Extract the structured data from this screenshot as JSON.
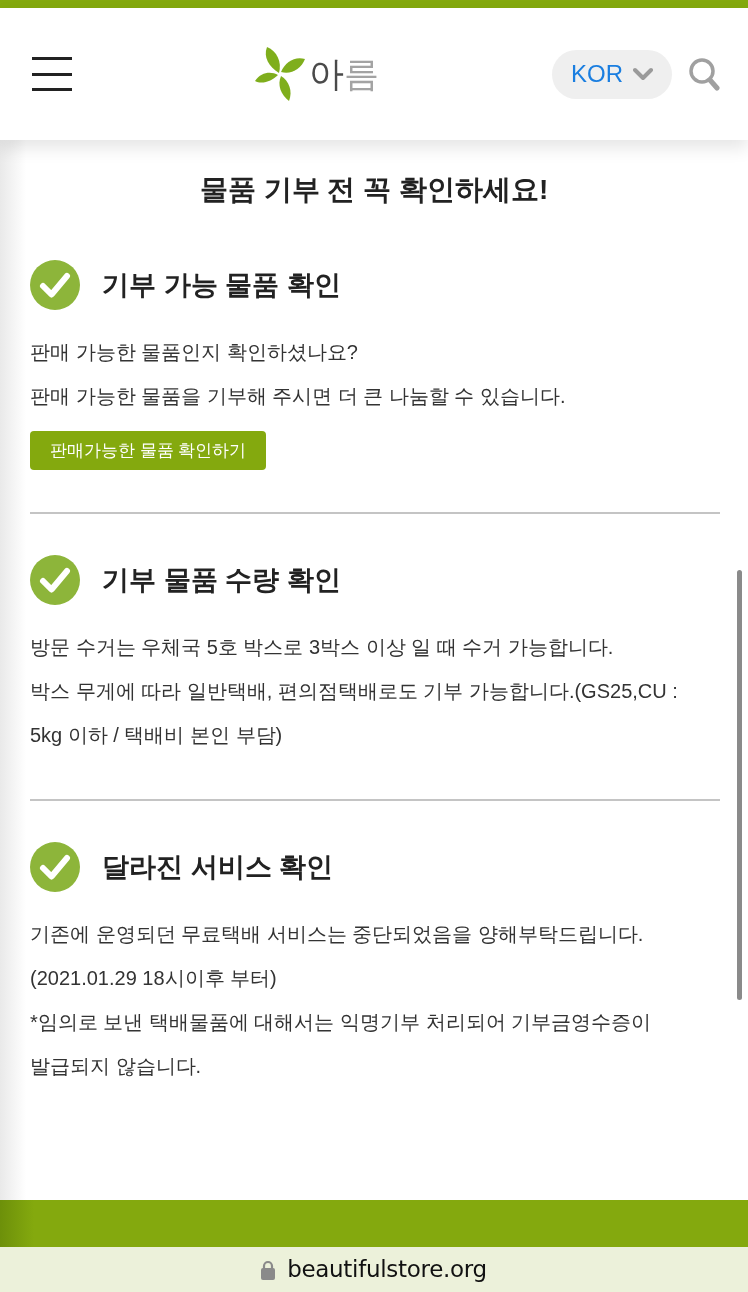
{
  "header": {
    "logo": {
      "text": "아름"
    },
    "language": {
      "label": "KOR"
    }
  },
  "page_title": "물품 기부 전 꼭 확인하세요!",
  "sections": [
    {
      "heading": "기부 가능 물품 확인",
      "lines": [
        "판매 가능한 물품인지 확인하셨나요?",
        "판매 가능한 물품을 기부해 주시면 더 큰 나눔할 수 있습니다."
      ],
      "button": "판매가능한 물품 확인하기"
    },
    {
      "heading": "기부 물품 수량 확인",
      "lines": [
        "방문 수거는 우체국 5호 박스로 3박스 이상 일 때 수거 가능합니다.",
        "박스 무게에 따라 일반택배, 편의점택배로도 기부 가능합니다.(GS25,CU : 5kg 이하 / 택배비 본인 부담)"
      ]
    },
    {
      "heading": "달라진 서비스 확인",
      "lines": [
        "기존에 운영되던 무료택배 서비스는 중단되었음을 양해부탁드립니다.",
        "(2021.01.29 18시이후 부터)",
        "*임의로 보낸 택배물품에 대해서는 익명기부 처리되어 기부금영수증이 발급되지 않습니다."
      ]
    }
  ],
  "address_bar": {
    "url": "beautifulstore.org"
  }
}
